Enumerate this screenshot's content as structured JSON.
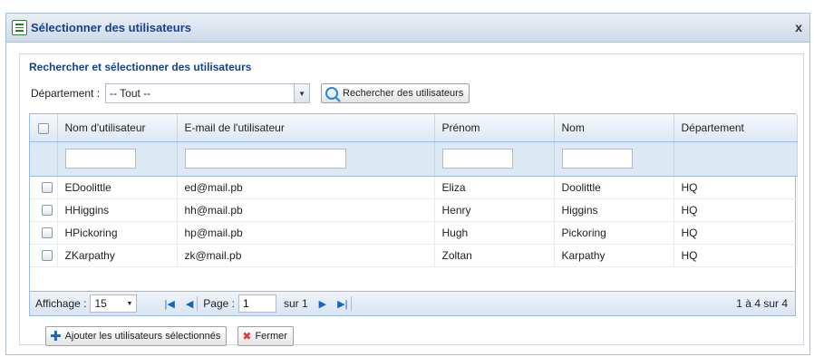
{
  "dialog": {
    "title": "Sélectionner des utilisateurs",
    "close_glyph": "x"
  },
  "section_title": "Rechercher et sélectionner des utilisateurs",
  "filter": {
    "label": "Département :",
    "selected": "-- Tout --",
    "search_button": "Rechercher des utilisateurs"
  },
  "grid": {
    "columns": [
      "Nom d'utilisateur",
      "E-mail de l'utilisateur",
      "Prénom",
      "Nom",
      "Département"
    ],
    "rows": [
      [
        "EDoolittle",
        "ed@mail.pb",
        "Eliza",
        "Doolittle",
        "HQ"
      ],
      [
        "HHiggins",
        "hh@mail.pb",
        "Henry",
        "Higgins",
        "HQ"
      ],
      [
        "HPickoring",
        "hp@mail.pb",
        "Hugh",
        "Pickoring",
        "HQ"
      ],
      [
        "ZKarpathy",
        "zk@mail.pb",
        "Zoltan",
        "Karpathy",
        "HQ"
      ]
    ]
  },
  "pager": {
    "display_label": "Affichage :",
    "page_size": "15",
    "page_label": "Page :",
    "page_value": "1",
    "of_label": "sur 1",
    "summary": "1 à 4 sur 4"
  },
  "buttons": {
    "add": "Ajouter les utilisateurs sélectionnés",
    "close": "Fermer"
  },
  "icons": {
    "app": "list-window-icon",
    "search": "magnifier-icon",
    "add": "plus-icon",
    "close": "red-x-icon"
  },
  "colors": {
    "title_text": "#15428b",
    "grid_border": "#99bbe8",
    "header_bg": "#dde8f5",
    "nav_blue": "#1565c0",
    "close_red": "#e53935"
  }
}
